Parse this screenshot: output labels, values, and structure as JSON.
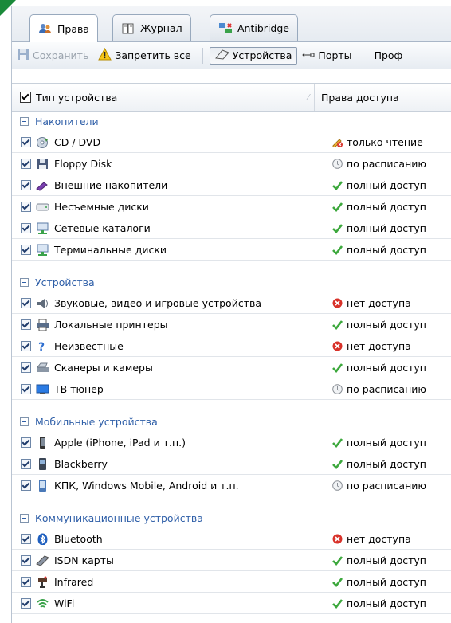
{
  "tabs": [
    {
      "label": "Права",
      "icon": "users-icon"
    },
    {
      "label": "Журнал",
      "icon": "journal-icon"
    },
    {
      "label": "Antibridge",
      "icon": "network-icon"
    }
  ],
  "toolbar": {
    "save_label": "Сохранить",
    "deny_all_label": "Запретить все",
    "devices_label": "Устройства",
    "ports_label": "Порты",
    "profiles_label": "Проф"
  },
  "columns": {
    "device_type": "Тип устройства",
    "access_rights": "Права доступа"
  },
  "colors": {
    "group": "#2f5fa8",
    "allow": "#3ca83c",
    "deny": "#d8322a",
    "schedule": "#8a8f96"
  },
  "groups": [
    {
      "title": "Накопители",
      "rows": [
        {
          "name": "CD / DVD",
          "icon": "cd-icon",
          "access": "только чтение",
          "status": "readonly"
        },
        {
          "name": "Floppy Disk",
          "icon": "floppy-icon",
          "access": "по расписанию",
          "status": "schedule"
        },
        {
          "name": "Внешние накопители",
          "icon": "usb-stick-icon",
          "access": "полный доступ",
          "status": "allow"
        },
        {
          "name": "Несъемные диски",
          "icon": "hdd-icon",
          "access": "полный доступ",
          "status": "allow"
        },
        {
          "name": "Сетевые каталоги",
          "icon": "network-drive-icon",
          "access": "полный доступ",
          "status": "allow"
        },
        {
          "name": "Терминальные диски",
          "icon": "terminal-drive-icon",
          "access": "полный доступ",
          "status": "allow"
        }
      ]
    },
    {
      "title": "Устройства",
      "rows": [
        {
          "name": "Звуковые, видео и игровые устройства",
          "icon": "speaker-icon",
          "access": "нет доступа",
          "status": "deny"
        },
        {
          "name": "Локальные принтеры",
          "icon": "printer-icon",
          "access": "полный доступ",
          "status": "allow"
        },
        {
          "name": "Неизвестные",
          "icon": "unknown-device-icon",
          "access": "нет доступа",
          "status": "deny"
        },
        {
          "name": "Сканеры и камеры",
          "icon": "scanner-icon",
          "access": "полный доступ",
          "status": "allow"
        },
        {
          "name": "ТВ тюнер",
          "icon": "tv-icon",
          "access": "по расписанию",
          "status": "schedule"
        }
      ]
    },
    {
      "title": "Мобильные устройства",
      "rows": [
        {
          "name": "Apple (iPhone, iPad и т.п.)",
          "icon": "phone-icon",
          "access": "полный доступ",
          "status": "allow"
        },
        {
          "name": "Blackberry",
          "icon": "blackberry-icon",
          "access": "полный доступ",
          "status": "allow"
        },
        {
          "name": "КПК, Windows Mobile, Android и т.п.",
          "icon": "pda-icon",
          "access": "по расписанию",
          "status": "schedule"
        }
      ]
    },
    {
      "title": "Коммуникационные устройства",
      "rows": [
        {
          "name": "Bluetooth",
          "icon": "bluetooth-icon",
          "access": "нет доступа",
          "status": "deny"
        },
        {
          "name": "ISDN карты",
          "icon": "isdn-card-icon",
          "access": "полный доступ",
          "status": "allow"
        },
        {
          "name": "Infrared",
          "icon": "infrared-icon",
          "access": "полный доступ",
          "status": "allow"
        },
        {
          "name": "WiFi",
          "icon": "wifi-icon",
          "access": "полный доступ",
          "status": "allow"
        }
      ]
    }
  ]
}
